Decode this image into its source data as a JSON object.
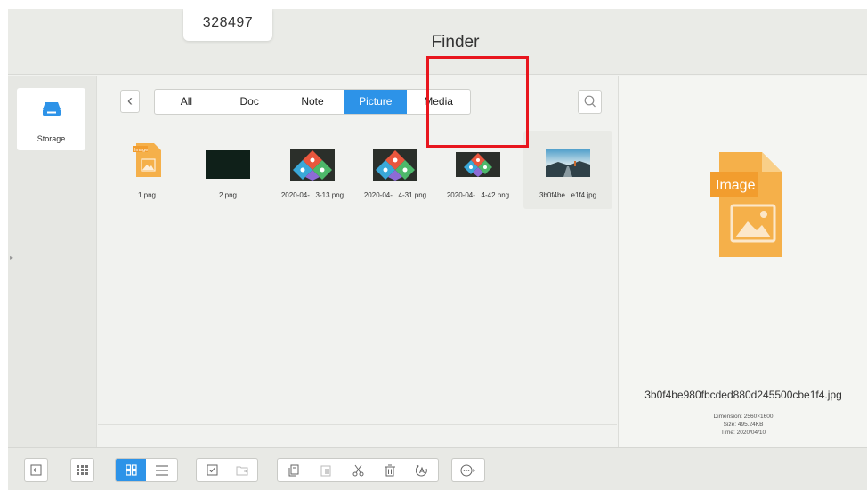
{
  "header": {
    "id_code": "328497",
    "title": "Finder"
  },
  "sidebar": {
    "storage_label": "Storage"
  },
  "tabs": [
    {
      "label": "All",
      "active": false
    },
    {
      "label": "Doc",
      "active": false
    },
    {
      "label": "Note",
      "active": false
    },
    {
      "label": "Picture",
      "active": true
    },
    {
      "label": "Media",
      "active": false
    }
  ],
  "files": [
    {
      "name": "1.png",
      "icon": "image-file-icon",
      "badge": "Image"
    },
    {
      "name": "2.png",
      "icon": "dark-thumbnail"
    },
    {
      "name": "2020-04-...3-13.png",
      "icon": "screenshot-thumbnail"
    },
    {
      "name": "2020-04-...4-31.png",
      "icon": "screenshot-thumbnail"
    },
    {
      "name": "2020-04-...4-42.png",
      "icon": "screenshot-thumbnail"
    },
    {
      "name": "3b0f4be...e1f4.jpg",
      "icon": "landscape-thumbnail",
      "selected": true
    }
  ],
  "detail": {
    "badge": "Image",
    "full_name": "3b0f4be980fbcded880d245500cbe1f4.jpg",
    "dimension": "Dimension: 2560×1600",
    "size": "Size: 495.24KB",
    "time": "Time: 2020/04/10"
  },
  "colors": {
    "accent": "#2d93e8",
    "image_orange": "#f5b04a",
    "highlight_red": "#e8161e"
  },
  "toolbar": {
    "buttons": [
      "exit-icon",
      "multi-grid-icon",
      "grid-view-icon",
      "list-view-icon",
      "select-icon",
      "move-icon",
      "copy-icon",
      "paste-icon",
      "cut-icon",
      "delete-icon",
      "rename-icon",
      "more-icon"
    ]
  }
}
